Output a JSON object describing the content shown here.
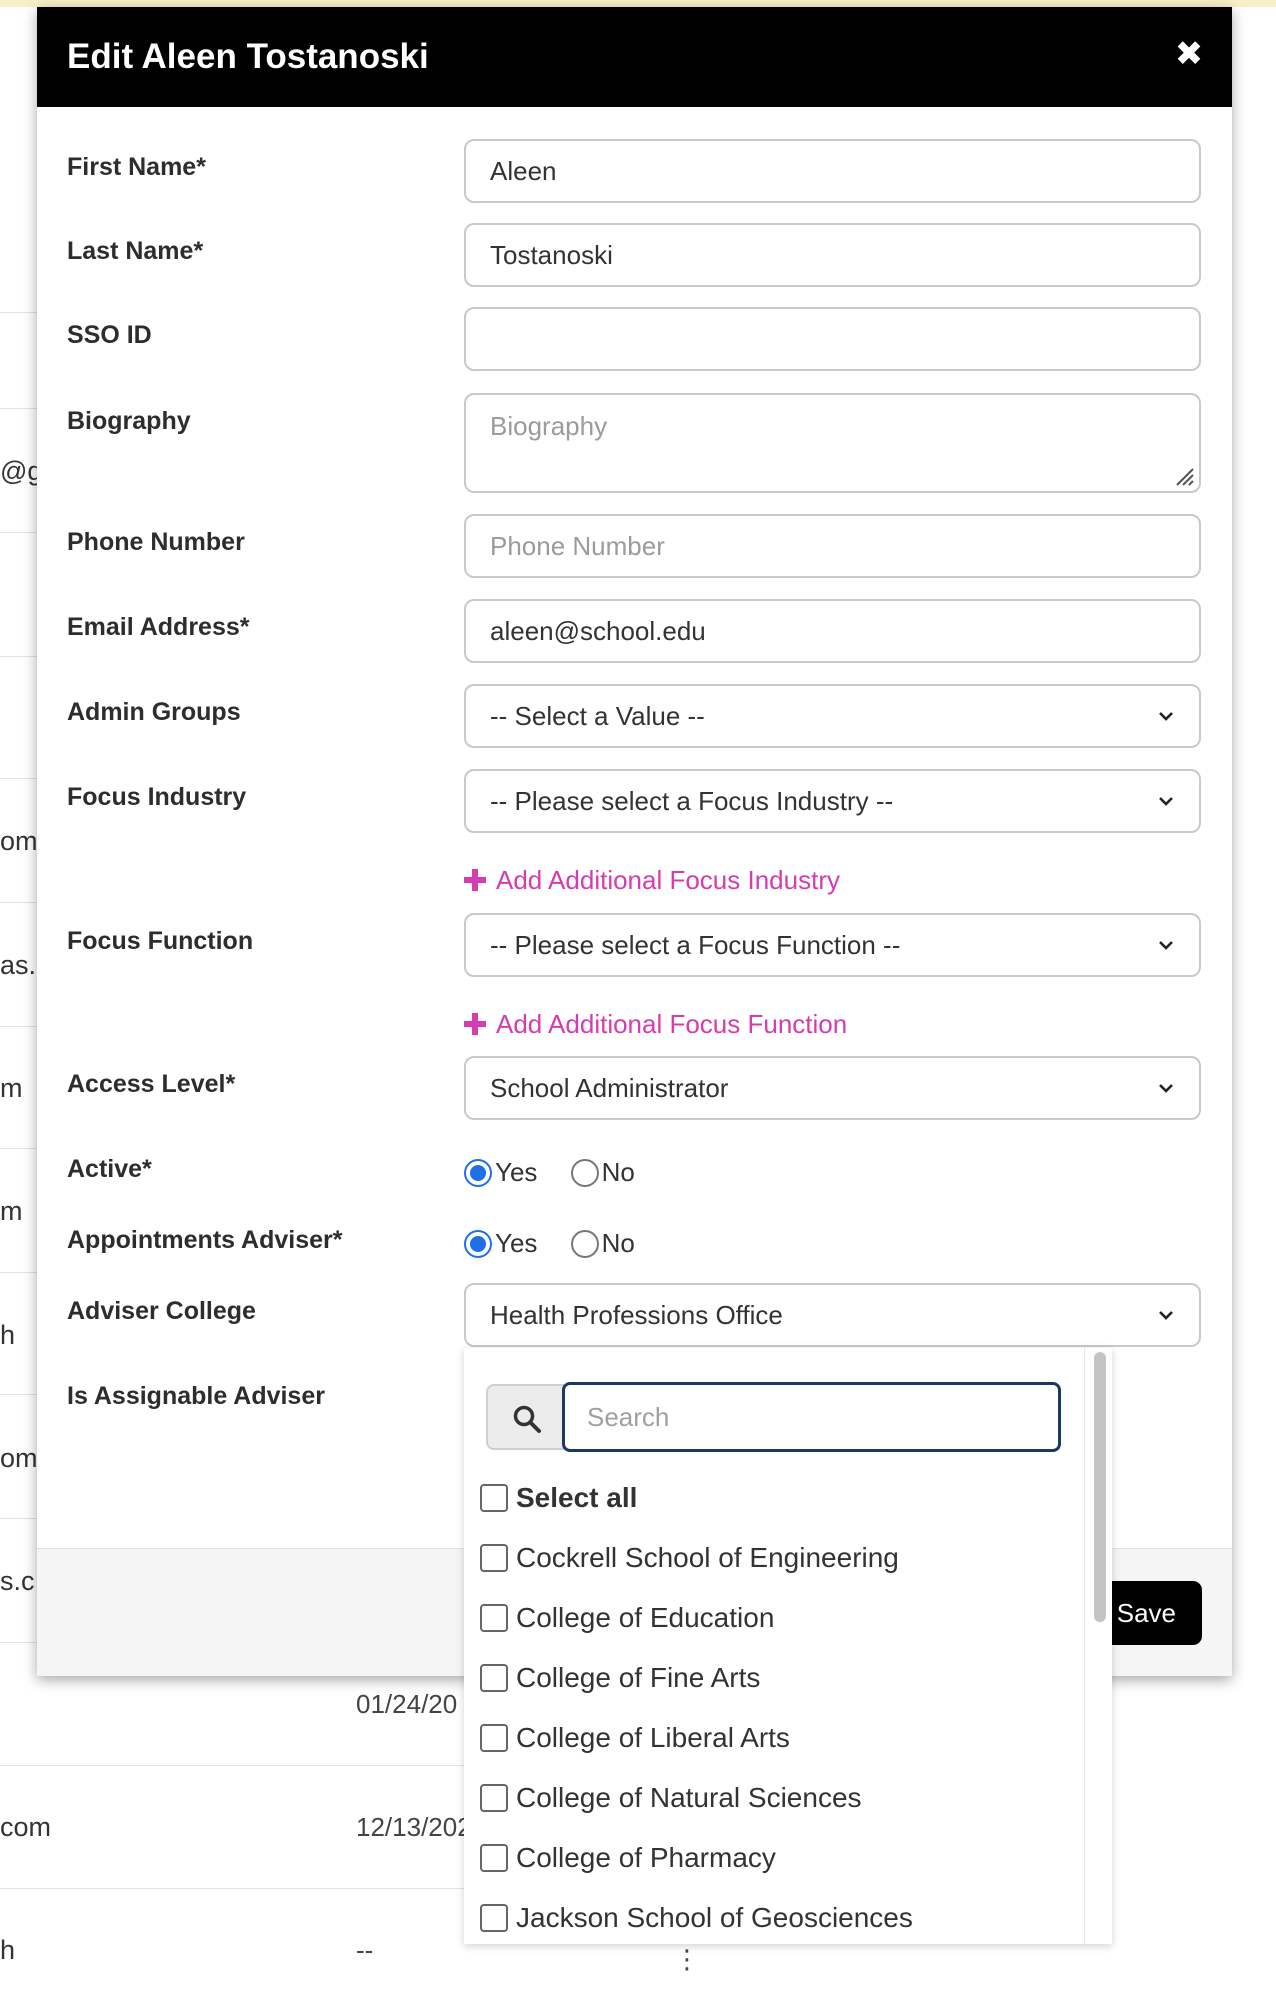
{
  "background": {
    "row_fragments": [
      "@g",
      "om",
      "as.c",
      "m",
      "m",
      "h",
      "om",
      "s.c",
      "com",
      "h"
    ],
    "dates": [
      "01/24/20",
      "12/13/202",
      "--"
    ],
    "row_action": "⋮"
  },
  "modal": {
    "title": "Edit Aleen Tostanoski",
    "close_icon": "close-icon",
    "save_label": "Save"
  },
  "form": {
    "first_name": {
      "label": "First Name*",
      "value": "Aleen"
    },
    "last_name": {
      "label": "Last Name*",
      "value": "Tostanoski"
    },
    "sso_id": {
      "label": "SSO ID",
      "value": ""
    },
    "biography": {
      "label": "Biography",
      "placeholder": "Biography"
    },
    "phone": {
      "label": "Phone Number",
      "placeholder": "Phone Number"
    },
    "email": {
      "label": "Email Address*",
      "value": "aleen@school.edu"
    },
    "admin_groups": {
      "label": "Admin Groups",
      "selected": "-- Select a Value --"
    },
    "focus_industry": {
      "label": "Focus Industry",
      "selected": "-- Please select a Focus Industry --",
      "add_label": "Add Additional Focus Industry"
    },
    "focus_function": {
      "label": "Focus Function",
      "selected": "-- Please select a Focus Function --",
      "add_label": "Add Additional Focus Function"
    },
    "access_level": {
      "label": "Access Level*",
      "selected": "School Administrator"
    },
    "active": {
      "label": "Active*",
      "options": [
        "Yes",
        "No"
      ],
      "selected": "Yes"
    },
    "appointments_adviser": {
      "label": "Appointments Adviser*",
      "options": [
        "Yes",
        "No"
      ],
      "selected": "Yes"
    },
    "adviser_college": {
      "label": "Adviser College",
      "selected": "Health Professions Office"
    },
    "is_assignable_adviser": {
      "label": "Is Assignable Adviser"
    }
  },
  "dropdown": {
    "search_placeholder": "Search",
    "select_all_label": "Select all",
    "options": [
      "Cockrell School of Engineering",
      "College of Education",
      "College of Fine Arts",
      "College of Liberal Arts",
      "College of Natural Sciences",
      "College of Pharmacy",
      "Jackson School of Geosciences"
    ]
  },
  "colors": {
    "accent_link": "#d63bb0",
    "radio_selected": "#1f6fe5",
    "header_bg": "#000000"
  }
}
